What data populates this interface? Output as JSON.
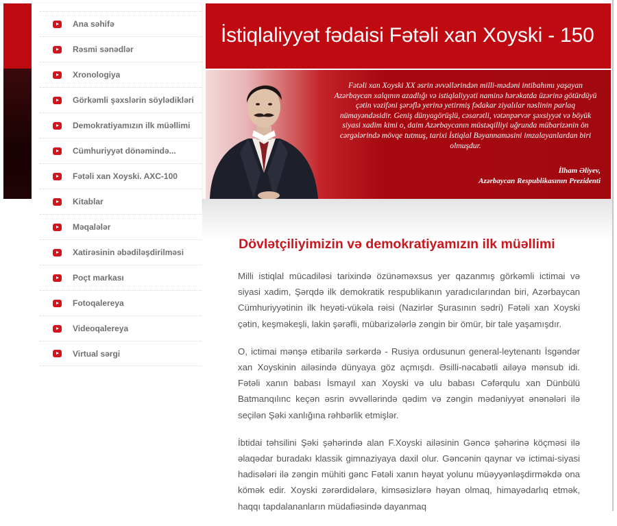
{
  "sidebar": {
    "items": [
      {
        "label": "Ana səhifə",
        "icon": "play-bullet-icon"
      },
      {
        "label": "Rəsmi sənədlər",
        "icon": "play-bullet-icon"
      },
      {
        "label": "Xronologiya",
        "icon": "play-bullet-icon"
      },
      {
        "label": "Görkəmli şəxslərin söylədikləri",
        "icon": "play-bullet-icon"
      },
      {
        "label": "Demokratiyamızın ilk müəllimi",
        "icon": "play-bullet-icon"
      },
      {
        "label": "Cümhuriyyət dönəmində...",
        "icon": "play-bullet-icon"
      },
      {
        "label": "Fətəli xan Xoyski. AXC-100",
        "icon": "play-bullet-icon"
      },
      {
        "label": "Kitablar",
        "icon": "play-bullet-icon"
      },
      {
        "label": "Məqalələr",
        "icon": "play-bullet-icon"
      },
      {
        "label": "Xatirəsinin əbədiləşdirilməsi",
        "icon": "play-bullet-icon"
      },
      {
        "label": "Poçt markası",
        "icon": "play-bullet-icon"
      },
      {
        "label": "Fotoqalereya",
        "icon": "play-bullet-icon"
      },
      {
        "label": "Videoqalereya",
        "icon": "play-bullet-icon"
      },
      {
        "label": "Virtual sərgi",
        "icon": "play-bullet-icon"
      }
    ]
  },
  "header": {
    "title": "İstiqlaliyyət fədaisi Fətəli xan Xoyski - 150"
  },
  "banner": {
    "quote": "Fətəli xan Xoyski XX əsrin əvvəllərindən milli-mədəni intibahımı yaşayan Azərbaycan xalqının azadlığı və istiqlaliyyəti naminə hərəkatda üzərinə götürdüyü çətin vəzifəni şərəflə yerinə yetirmiş fədakar ziyalılar nəslinin parlaq nümayəndəsidir. Geniş dünyagörüşlü, cəsarətli, vətənpərvər şəxsiyyət və böyük siyasi xadim kimi o, daim Azərbaycanın müstəqilliyi uğrunda mübarizənin ön cərgələrində mövqe tutmuş, tarixi İstiqlal Bəyannaməsini imzalayanlardan biri olmuşdur.",
    "author_name": "İlham Əliyev,",
    "author_title": "Azərbaycan Respublikasının Prezidenti"
  },
  "article": {
    "title": "Dövlətçiliyimizin və demokratiyamızın ilk müəllimi",
    "paragraphs": [
      "Milli istiqlal mücadiləsi tarixində özünəməxsus yer qazanmış görkəmli ictimai və siyasi xadim, Şərqdə ilk demokratik respublikanın yaradıcılarından biri, Azərbaycan Cümhuriyyətinin ilk heyəti-vükəla rəisi (Nazirlər Şurasının sədri) Fətəli xan Xoyski çətin, keşməkeşli, lakin şərəfli, mübarizələrlə zəngin bir ömür, bir tale yaşamışdır.",
      "O, ictimai mənşə etibarilə sərkərdə - Rusiya ordusunun general-leytenantı İsgəndər xan Xoyskinin ailəsində dünyaya göz açmışdı. Əsilli-nəcabətli ailəyə mənsub idi. Fətəli xanın babası İsmayıl xan Xoyski və ulu babası Cəfərqulu xan Dünbülü Batmanqılınc keçən əsrin əvvəllərində qədim və zəngin mədəniyyət ənənələri ilə seçilən Şəki xanlığına rəhbərlik etmişlər.",
      "İbtidai təhsilini Şəki şəhərində alan F.Xoyski ailəsinin Gəncə şəhərinə köçməsi ilə əlaqədar buradakı klassik gimnaziyaya daxil olur. Gəncənin qaynar və ictimai-siyasi hadisələri ilə zəngin mühiti gənc Fətəli xanın həyat yolunu müəyyənləşdirməkdə ona kömək edir. Xoyski zərərdidələrə, kimsəsizlərə həyan olmaq, himayədarlıq etmək, haqqı tapdalananların müdafiəsində dayanmaq"
    ]
  },
  "colors": {
    "brand_red": "#c00a12",
    "title_red": "#c8181f",
    "menu_text": "#6f6f6f"
  }
}
